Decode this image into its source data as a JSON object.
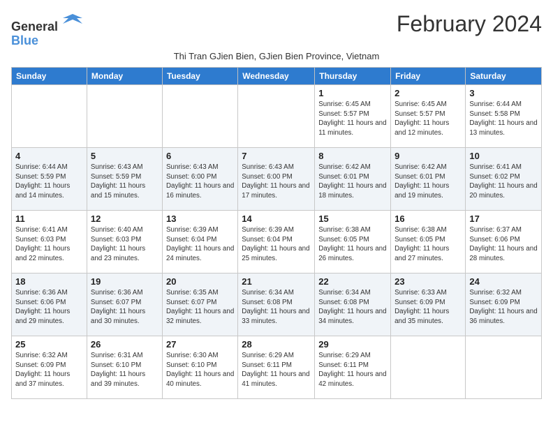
{
  "header": {
    "logo_general": "General",
    "logo_blue": "Blue",
    "title": "February 2024",
    "subtitle": "Thi Tran GJien Bien, GJien Bien Province, Vietnam"
  },
  "days": [
    "Sunday",
    "Monday",
    "Tuesday",
    "Wednesday",
    "Thursday",
    "Friday",
    "Saturday"
  ],
  "weeks": [
    [
      {
        "date": "",
        "info": ""
      },
      {
        "date": "",
        "info": ""
      },
      {
        "date": "",
        "info": ""
      },
      {
        "date": "",
        "info": ""
      },
      {
        "date": "1",
        "info": "Sunrise: 6:45 AM\nSunset: 5:57 PM\nDaylight: 11 hours and 11 minutes."
      },
      {
        "date": "2",
        "info": "Sunrise: 6:45 AM\nSunset: 5:57 PM\nDaylight: 11 hours and 12 minutes."
      },
      {
        "date": "3",
        "info": "Sunrise: 6:44 AM\nSunset: 5:58 PM\nDaylight: 11 hours and 13 minutes."
      }
    ],
    [
      {
        "date": "4",
        "info": "Sunrise: 6:44 AM\nSunset: 5:59 PM\nDaylight: 11 hours and 14 minutes."
      },
      {
        "date": "5",
        "info": "Sunrise: 6:43 AM\nSunset: 5:59 PM\nDaylight: 11 hours and 15 minutes."
      },
      {
        "date": "6",
        "info": "Sunrise: 6:43 AM\nSunset: 6:00 PM\nDaylight: 11 hours and 16 minutes."
      },
      {
        "date": "7",
        "info": "Sunrise: 6:43 AM\nSunset: 6:00 PM\nDaylight: 11 hours and 17 minutes."
      },
      {
        "date": "8",
        "info": "Sunrise: 6:42 AM\nSunset: 6:01 PM\nDaylight: 11 hours and 18 minutes."
      },
      {
        "date": "9",
        "info": "Sunrise: 6:42 AM\nSunset: 6:01 PM\nDaylight: 11 hours and 19 minutes."
      },
      {
        "date": "10",
        "info": "Sunrise: 6:41 AM\nSunset: 6:02 PM\nDaylight: 11 hours and 20 minutes."
      }
    ],
    [
      {
        "date": "11",
        "info": "Sunrise: 6:41 AM\nSunset: 6:03 PM\nDaylight: 11 hours and 22 minutes."
      },
      {
        "date": "12",
        "info": "Sunrise: 6:40 AM\nSunset: 6:03 PM\nDaylight: 11 hours and 23 minutes."
      },
      {
        "date": "13",
        "info": "Sunrise: 6:39 AM\nSunset: 6:04 PM\nDaylight: 11 hours and 24 minutes."
      },
      {
        "date": "14",
        "info": "Sunrise: 6:39 AM\nSunset: 6:04 PM\nDaylight: 11 hours and 25 minutes."
      },
      {
        "date": "15",
        "info": "Sunrise: 6:38 AM\nSunset: 6:05 PM\nDaylight: 11 hours and 26 minutes."
      },
      {
        "date": "16",
        "info": "Sunrise: 6:38 AM\nSunset: 6:05 PM\nDaylight: 11 hours and 27 minutes."
      },
      {
        "date": "17",
        "info": "Sunrise: 6:37 AM\nSunset: 6:06 PM\nDaylight: 11 hours and 28 minutes."
      }
    ],
    [
      {
        "date": "18",
        "info": "Sunrise: 6:36 AM\nSunset: 6:06 PM\nDaylight: 11 hours and 29 minutes."
      },
      {
        "date": "19",
        "info": "Sunrise: 6:36 AM\nSunset: 6:07 PM\nDaylight: 11 hours and 30 minutes."
      },
      {
        "date": "20",
        "info": "Sunrise: 6:35 AM\nSunset: 6:07 PM\nDaylight: 11 hours and 32 minutes."
      },
      {
        "date": "21",
        "info": "Sunrise: 6:34 AM\nSunset: 6:08 PM\nDaylight: 11 hours and 33 minutes."
      },
      {
        "date": "22",
        "info": "Sunrise: 6:34 AM\nSunset: 6:08 PM\nDaylight: 11 hours and 34 minutes."
      },
      {
        "date": "23",
        "info": "Sunrise: 6:33 AM\nSunset: 6:09 PM\nDaylight: 11 hours and 35 minutes."
      },
      {
        "date": "24",
        "info": "Sunrise: 6:32 AM\nSunset: 6:09 PM\nDaylight: 11 hours and 36 minutes."
      }
    ],
    [
      {
        "date": "25",
        "info": "Sunrise: 6:32 AM\nSunset: 6:09 PM\nDaylight: 11 hours and 37 minutes."
      },
      {
        "date": "26",
        "info": "Sunrise: 6:31 AM\nSunset: 6:10 PM\nDaylight: 11 hours and 39 minutes."
      },
      {
        "date": "27",
        "info": "Sunrise: 6:30 AM\nSunset: 6:10 PM\nDaylight: 11 hours and 40 minutes."
      },
      {
        "date": "28",
        "info": "Sunrise: 6:29 AM\nSunset: 6:11 PM\nDaylight: 11 hours and 41 minutes."
      },
      {
        "date": "29",
        "info": "Sunrise: 6:29 AM\nSunset: 6:11 PM\nDaylight: 11 hours and 42 minutes."
      },
      {
        "date": "",
        "info": ""
      },
      {
        "date": "",
        "info": ""
      }
    ]
  ]
}
